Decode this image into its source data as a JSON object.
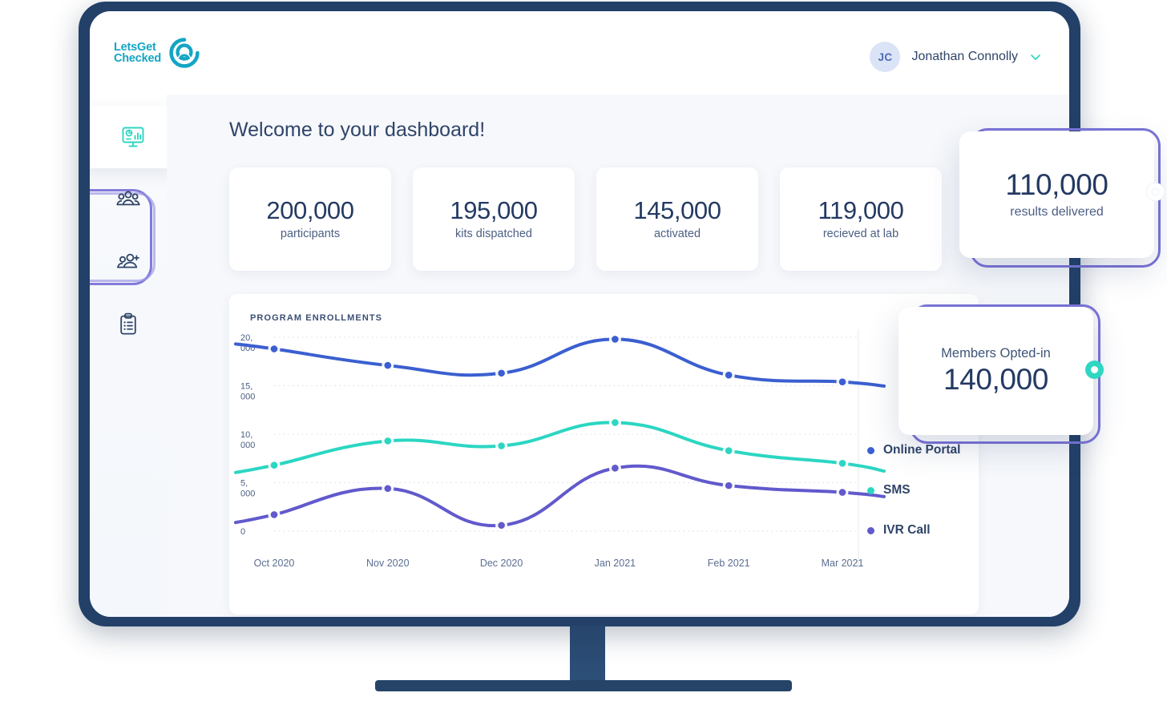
{
  "brand": {
    "line1": "LetsGet",
    "line2": "Checked",
    "color": "#14A5C4",
    "mark_icon": "lgc-ring-icon"
  },
  "header": {
    "user": {
      "initials": "JC",
      "name": "Jonathan Connolly",
      "chevron_icon": "chevron-down-icon"
    }
  },
  "sidebar": {
    "items": [
      {
        "icon": "dashboard-monitor-chart-icon",
        "name": "dashboard",
        "active": true
      },
      {
        "icon": "people-group-icon",
        "name": "participants",
        "active": false
      },
      {
        "icon": "add-person-icon",
        "name": "add-member",
        "active": false
      },
      {
        "icon": "clipboard-list-icon",
        "name": "reports",
        "active": false
      }
    ]
  },
  "main": {
    "welcome_title": "Welcome to your dashboard!",
    "stats": [
      {
        "value": "200,000",
        "label": "participants"
      },
      {
        "value": "195,000",
        "label": "kits dispatched"
      },
      {
        "value": "145,000",
        "label": "activated"
      },
      {
        "value": "119,000",
        "label": "recieved at lab"
      }
    ]
  },
  "overlays": {
    "results": {
      "value": "110,000",
      "label": "results delivered",
      "knob_color": "#4a6fd6"
    },
    "members": {
      "title": "Members Opted-in",
      "value": "140,000",
      "knob_color": "#2fd6c2"
    }
  },
  "chart_data": {
    "type": "line",
    "title": "PROGRAM ENROLLMENTS",
    "xlabel": "",
    "ylabel": "",
    "x": [
      "Oct 2020",
      "Nov 2020",
      "Dec 2020",
      "Jan 2021",
      "Feb 2021",
      "Mar 2021"
    ],
    "xtick_labels": [
      "Oct 2020",
      "Nov 2020",
      "Dec 2020",
      "Jan 2021",
      "Feb 2021",
      "Mar 2021"
    ],
    "ytick_labels": [
      "20,000",
      "15,000",
      "10,000",
      "5,000",
      "0"
    ],
    "ylim": [
      0,
      20000
    ],
    "yticks": [
      20000,
      15000,
      10000,
      5000,
      0
    ],
    "grid": true,
    "legend_position": "right",
    "series": [
      {
        "name": "Online Portal",
        "color": "#3b5fd0",
        "values": [
          18800,
          17100,
          16300,
          19800,
          16100,
          15400
        ]
      },
      {
        "name": "SMS",
        "color": "#2bd6c2",
        "values": [
          6800,
          9300,
          8800,
          11200,
          8300,
          7000
        ]
      },
      {
        "name": "IVR Call",
        "color": "#6159cc",
        "values": [
          1700,
          4400,
          600,
          6500,
          4700,
          4000
        ]
      }
    ]
  }
}
